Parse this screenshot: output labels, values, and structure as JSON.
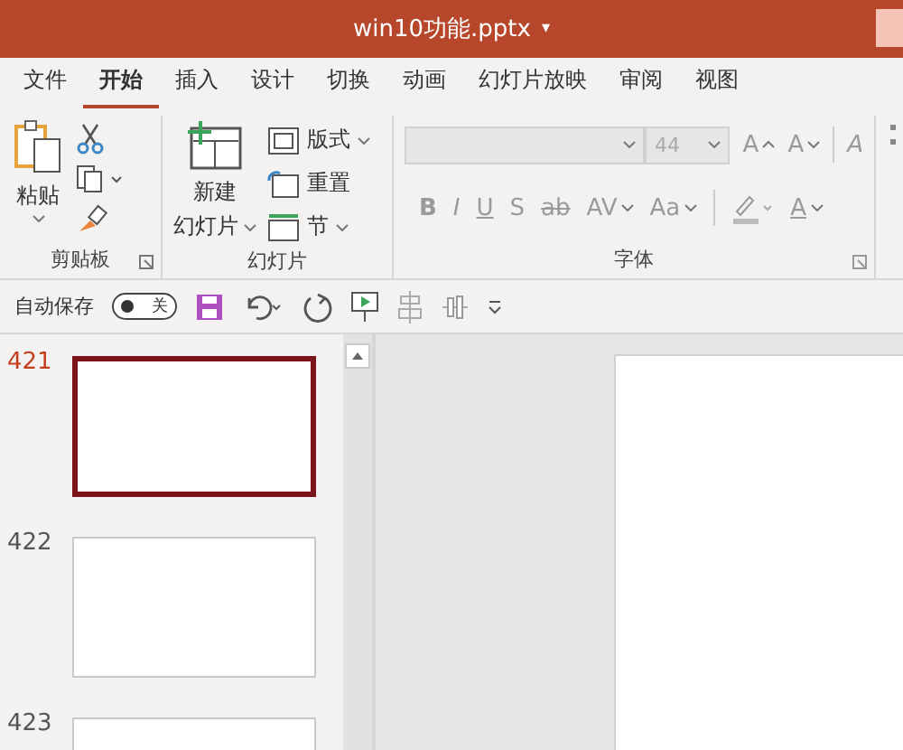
{
  "window": {
    "title": "win10功能.pptx",
    "title_caret": "▾"
  },
  "tabs": [
    {
      "label": "文件",
      "selected": false
    },
    {
      "label": "开始",
      "selected": true
    },
    {
      "label": "插入",
      "selected": false
    },
    {
      "label": "设计",
      "selected": false
    },
    {
      "label": "切换",
      "selected": false
    },
    {
      "label": "动画",
      "selected": false
    },
    {
      "label": "幻灯片放映",
      "selected": false
    },
    {
      "label": "审阅",
      "selected": false
    },
    {
      "label": "视图",
      "selected": false
    }
  ],
  "ribbon": {
    "clipboard": {
      "paste": "粘贴",
      "label": "剪贴板"
    },
    "slides": {
      "new_slide": [
        "新建",
        "幻灯片"
      ],
      "items": [
        {
          "kind": "layout",
          "label": "版式",
          "caret": true
        },
        {
          "kind": "reset",
          "label": "重置",
          "caret": false
        },
        {
          "kind": "section",
          "label": "节",
          "caret": true
        }
      ],
      "label": "幻灯片"
    },
    "font": {
      "disabled": true,
      "size": "44",
      "grow": "A",
      "shrink": "A",
      "clear": "A",
      "styles": [
        {
          "kind": "bold",
          "label": "B"
        },
        {
          "kind": "italic",
          "label": "I"
        },
        {
          "kind": "underline",
          "label": "U"
        },
        {
          "kind": "shadow",
          "label": "S"
        },
        {
          "kind": "strike",
          "label": "ab"
        },
        {
          "kind": "spacing",
          "label": "AV"
        },
        {
          "kind": "case",
          "label": "Aa"
        }
      ],
      "font_color_letter": "A",
      "label": "字体"
    }
  },
  "quick_access": {
    "autosave_label": "自动保存",
    "autosave": {
      "on": false,
      "label": "关"
    }
  },
  "slides": [
    {
      "number": "421",
      "selected": true
    },
    {
      "number": "422",
      "selected": false
    },
    {
      "number": "423",
      "selected": false
    }
  ]
}
